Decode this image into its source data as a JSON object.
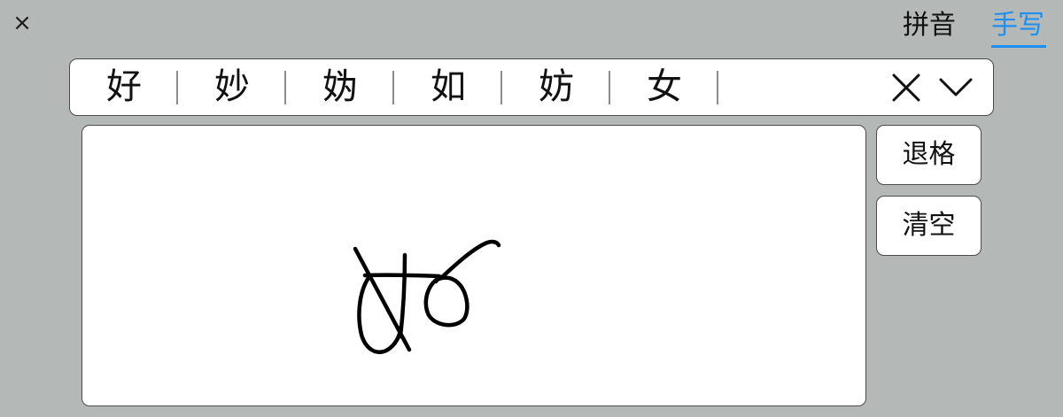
{
  "close": {
    "label": "×"
  },
  "tabs": [
    {
      "label": "拼音",
      "active": false
    },
    {
      "label": "手写",
      "active": true
    }
  ],
  "candidates": [
    "好",
    "妙",
    "妫",
    "如",
    "妨",
    "女"
  ],
  "candidate_bar": {
    "close_icon": "close-icon",
    "expand_icon": "chevron-down-icon"
  },
  "actions": {
    "backspace": "退格",
    "clear": "清空"
  },
  "colors": {
    "background": "#b4b9b7",
    "accent": "#1e8ef0",
    "panel": "#ffffff",
    "ink": "#000000"
  }
}
